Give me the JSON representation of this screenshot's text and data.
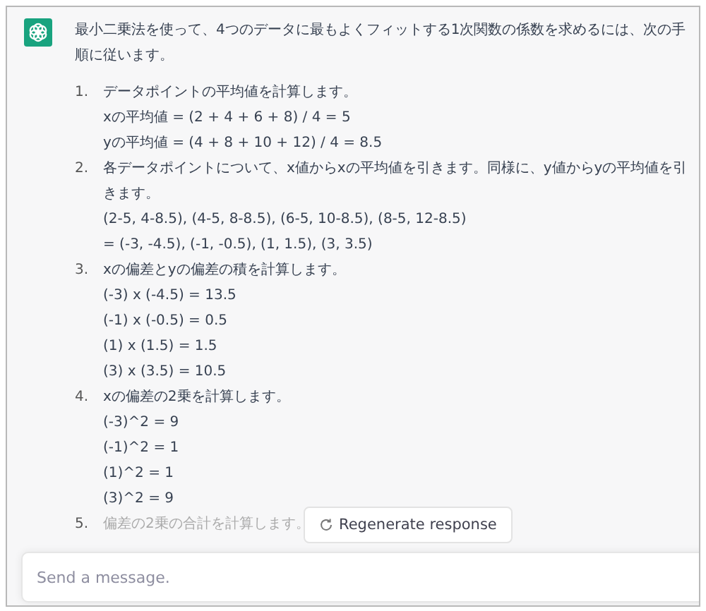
{
  "message": {
    "text": "最小二乗法を使って、4つのデータに最もよくフィットする1次関数の係数を求めるには、次の手順に従います。",
    "steps": [
      {
        "number": "1.",
        "text": "データポイントの平均値を計算します。",
        "lines": [
          "xの平均値 = (2 + 4 + 6 + 8) / 4 = 5",
          "yの平均値 = (4 + 8 + 10 + 12) / 4 = 8.5"
        ]
      },
      {
        "number": "2.",
        "text": "各データポイントについて、x値からxの平均値を引きます。同様に、y値からyの平均値を引きます。",
        "lines": [
          "(2-5, 4-8.5), (4-5, 8-8.5), (6-5, 10-8.5), (8-5, 12-8.5)",
          "= (-3, -4.5), (-1, -0.5), (1, 1.5), (3, 3.5)"
        ]
      },
      {
        "number": "3.",
        "text": "xの偏差とyの偏差の積を計算します。",
        "lines": [
          "(-3) x (-4.5) = 13.5",
          "(-1) x (-0.5) = 0.5",
          "(1) x (1.5) = 1.5",
          "(3) x (3.5) = 10.5"
        ]
      },
      {
        "number": "4.",
        "text": "xの偏差の2乗を計算します。",
        "lines": [
          "(-3)^2 = 9",
          "(-1)^2 = 1",
          "(1)^2 = 1",
          "(3)^2 = 9"
        ]
      },
      {
        "number": "5.",
        "text": "偏差の2乗の合計を計算します。"
      }
    ]
  },
  "regenerate_button": {
    "label": "Regenerate response"
  },
  "composer": {
    "placeholder": "Send a message."
  }
}
